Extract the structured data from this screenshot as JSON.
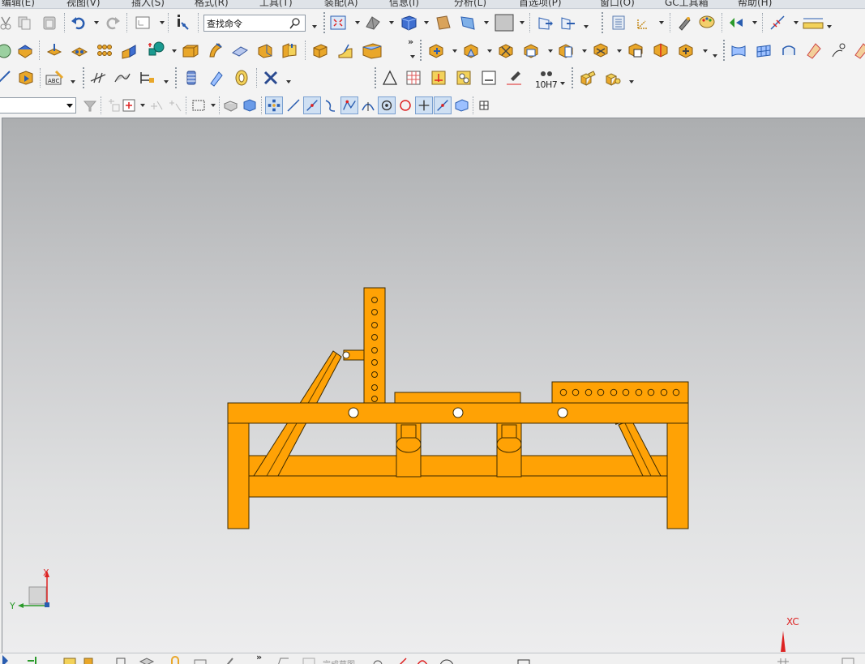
{
  "menu": {
    "items": [
      "编辑(E)",
      "视图(V)",
      "插入(S)",
      "格式(R)",
      "工具(T)",
      "装配(A)",
      "信息(I)",
      "分析(L)",
      "首选项(P)",
      "窗口(O)",
      "GC工具箱",
      "帮助(H)"
    ]
  },
  "search": {
    "placeholder": "查找命令"
  },
  "selection_filter": {
    "value": ""
  },
  "toolbar": {
    "tolerance_label": "10H7",
    "more_glyph": "»"
  },
  "bottom": {
    "status_text": "完成草图"
  },
  "triad": {
    "x_label": "X",
    "y_label": "Y"
  },
  "wcs": {
    "xc_label": "XC"
  },
  "colors": {
    "model": "#ffa205",
    "model_stroke": "#3d2a00",
    "accent": "#2060c0"
  },
  "icons": {
    "row1": [
      "cut-icon",
      "copy-icon",
      "paste-icon",
      "undo-icon",
      "redo-icon",
      "layout-icon",
      "info-icon",
      "fit-view-icon",
      "shade-icon",
      "solid-cube-icon",
      "face-icon",
      "view-orient-icon",
      "background-icon",
      "wcs-icon",
      "snap-icon",
      "layer-icon",
      "csys-icon",
      "paint-icon",
      "palette-icon",
      "point-icon",
      "measure-icon",
      "ruler-icon"
    ],
    "row2": [
      "plane-icon",
      "block-icon",
      "datum-icon",
      "array-icon",
      "dots-icon",
      "extrude-icon",
      "revolve-icon",
      "boolean-icon",
      "sweep-icon",
      "blend-icon",
      "chamfer-icon",
      "shell-icon",
      "surface-icon",
      "edge-blend-icon",
      "offset-icon",
      "trim-icon",
      "pattern-icon",
      "mirror-icon",
      "draft-icon",
      "thicken-icon",
      "sew-icon",
      "studio-icon"
    ],
    "row3": [
      "sketch-icon",
      "constraint-icon",
      "text-icon",
      "curve-icon",
      "spline-icon",
      "section-icon",
      "spring-icon",
      "gear-icon",
      "bearing-icon",
      "tool-icon",
      "triangle-icon",
      "table-icon",
      "dimension-icon",
      "note-icon",
      "drawing-icon",
      "brush-icon",
      "tolerance-icon",
      "assembly-icon",
      "component-icon"
    ],
    "row4": [
      "filter-icon",
      "select-all-icon",
      "point-snap-icon",
      "end-snap-icon",
      "mid-snap-icon",
      "curve-snap-icon",
      "intersect-snap-icon",
      "center-snap-icon",
      "quadrant-snap-icon",
      "plus-snap-icon",
      "line-snap-icon",
      "view-select-icon",
      "grid-icon"
    ]
  }
}
